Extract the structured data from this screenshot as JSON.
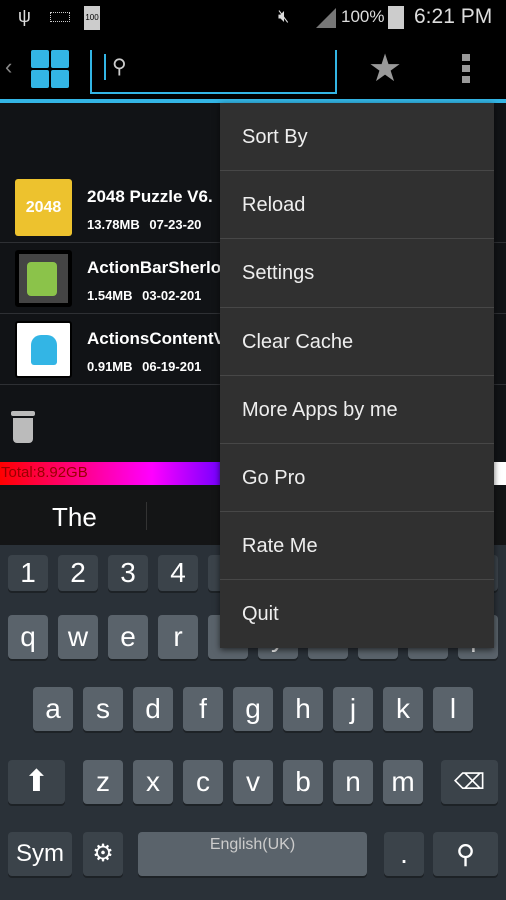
{
  "status_bar": {
    "battery_badge": "100",
    "battery_percent": "100%",
    "time": "6:21 PM"
  },
  "action_bar": {
    "search_placeholder": "",
    "accent_color": "#33b5e5"
  },
  "apps": [
    {
      "name": "2048 Puzzle V6.",
      "meta": "13.78MB 07-23-20"
    },
    {
      "name": "ActionBarSherlo",
      "meta": "1.54MB 03-02-201"
    },
    {
      "name": "ActionsContentV",
      "meta": "0.91MB 06-19-201"
    }
  ],
  "storage": {
    "total_label": "Total:8.92GB"
  },
  "icon_2048_text": "2048",
  "suggestion": {
    "word": "The"
  },
  "menu": {
    "items": [
      "Sort By",
      "Reload",
      "Settings",
      "Clear Cache",
      "More Apps by me",
      "Go Pro",
      "Rate Me",
      "Quit"
    ]
  },
  "keyboard": {
    "numbers": [
      "1",
      "2",
      "3",
      "4"
    ],
    "row1": [
      "q",
      "w",
      "e",
      "r",
      "t",
      "y",
      "u",
      "i",
      "o",
      "p"
    ],
    "row2": [
      "a",
      "s",
      "d",
      "f",
      "g",
      "h",
      "j",
      "k",
      "l"
    ],
    "row3": [
      "z",
      "x",
      "c",
      "v",
      "b",
      "n",
      "m"
    ],
    "sym": "Sym",
    "space": "English(UK)",
    "period": "."
  }
}
